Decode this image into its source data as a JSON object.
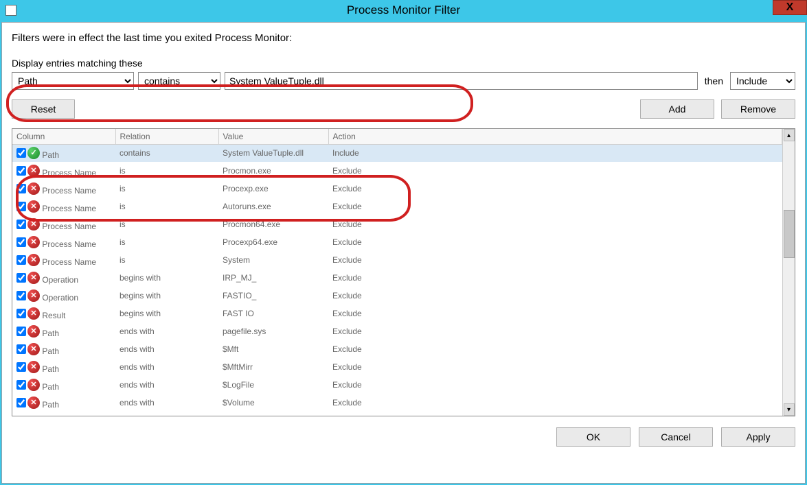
{
  "window": {
    "title": "Process Monitor Filter",
    "close": "X"
  },
  "intro": "Filters were in effect the last time you exited Process Monitor:",
  "legend": "Display entries matching these",
  "filter": {
    "column": "Path",
    "relation": "contains",
    "value": "System ValueTuple.dll",
    "then_label": "then",
    "action": "Include"
  },
  "buttons": {
    "reset": "Reset",
    "add": "Add",
    "remove": "Remove",
    "ok": "OK",
    "cancel": "Cancel",
    "apply": "Apply"
  },
  "headers": {
    "column": "Column",
    "relation": "Relation",
    "value": "Value",
    "action": "Action"
  },
  "rows": [
    {
      "checked": true,
      "kind": "include",
      "column": "Path",
      "relation": "contains",
      "value": "System ValueTuple.dll",
      "action": "Include",
      "selected": true
    },
    {
      "checked": true,
      "kind": "exclude",
      "column": "Process Name",
      "relation": "is",
      "value": "Procmon.exe",
      "action": "Exclude"
    },
    {
      "checked": true,
      "kind": "exclude",
      "column": "Process Name",
      "relation": "is",
      "value": "Procexp.exe",
      "action": "Exclude"
    },
    {
      "checked": true,
      "kind": "exclude",
      "column": "Process Name",
      "relation": "is",
      "value": "Autoruns.exe",
      "action": "Exclude"
    },
    {
      "checked": true,
      "kind": "exclude",
      "column": "Process Name",
      "relation": "is",
      "value": "Procmon64.exe",
      "action": "Exclude"
    },
    {
      "checked": true,
      "kind": "exclude",
      "column": "Process Name",
      "relation": "is",
      "value": "Procexp64.exe",
      "action": "Exclude"
    },
    {
      "checked": true,
      "kind": "exclude",
      "column": "Process Name",
      "relation": "is",
      "value": "System",
      "action": "Exclude"
    },
    {
      "checked": true,
      "kind": "exclude",
      "column": "Operation",
      "relation": "begins with",
      "value": "IRP_MJ_",
      "action": "Exclude"
    },
    {
      "checked": true,
      "kind": "exclude",
      "column": "Operation",
      "relation": "begins with",
      "value": "FASTIO_",
      "action": "Exclude"
    },
    {
      "checked": true,
      "kind": "exclude",
      "column": "Result",
      "relation": "begins with",
      "value": "FAST IO",
      "action": "Exclude"
    },
    {
      "checked": true,
      "kind": "exclude",
      "column": "Path",
      "relation": "ends with",
      "value": "pagefile.sys",
      "action": "Exclude"
    },
    {
      "checked": true,
      "kind": "exclude",
      "column": "Path",
      "relation": "ends with",
      "value": "$Mft",
      "action": "Exclude"
    },
    {
      "checked": true,
      "kind": "exclude",
      "column": "Path",
      "relation": "ends with",
      "value": "$MftMirr",
      "action": "Exclude"
    },
    {
      "checked": true,
      "kind": "exclude",
      "column": "Path",
      "relation": "ends with",
      "value": "$LogFile",
      "action": "Exclude"
    },
    {
      "checked": true,
      "kind": "exclude",
      "column": "Path",
      "relation": "ends with",
      "value": "$Volume",
      "action": "Exclude"
    }
  ]
}
